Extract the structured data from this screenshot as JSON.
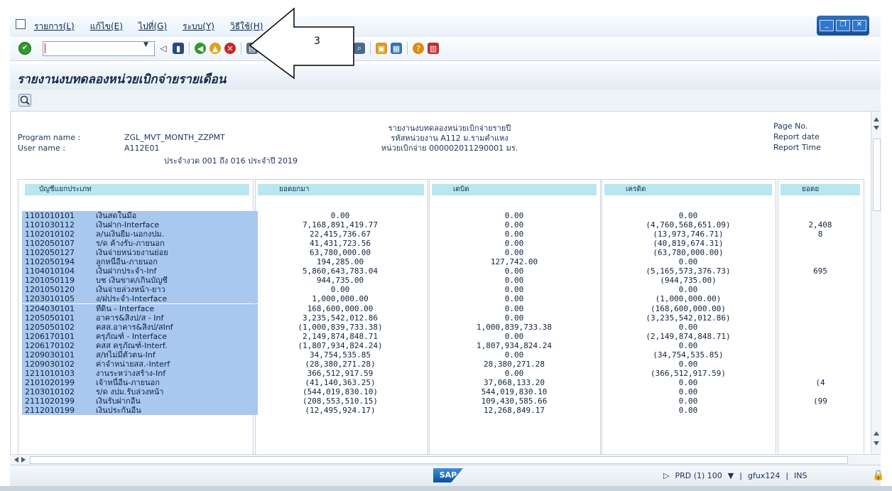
{
  "menu": {
    "items": [
      "รายการ(L)",
      "แก้ไข(E)",
      "ไปที่(G)",
      "ระบบ(Y)",
      "วิธีใช้(H)"
    ]
  },
  "toolbar": {
    "command_value": "",
    "icons": [
      "enter-icon",
      "back-icon",
      "save-icon",
      "back-green-icon",
      "exit-icon",
      "cancel-icon",
      "print-icon",
      "find-icon",
      "new-session-icon",
      "layout-icon",
      "help-icon",
      "customize-icon"
    ]
  },
  "callout": {
    "label": "3"
  },
  "title": "รายงานงบทดลองหน่วยเบิกจ่ายรายเดือน",
  "report": {
    "center_lines": [
      "รายงานงบทดลองหน่วยเบิกจ่ายรายปี",
      "รหัสหน่วยงาน A112 ม.รามคำแหง",
      "หน่วยเบิกจ่าย 000002011290001 มร."
    ],
    "program_label": "Program name  :",
    "program_value": "ZGL_MVT_MONTH_ZZPMT",
    "user_label": "User name    :",
    "user_value": "A112E01",
    "period": "ประจำงวด 001 ถึง 016 ประจำปี 2019",
    "right_labels": [
      "Page No.",
      "Report date",
      "Report Time"
    ],
    "columns": [
      "บัญชีแยกประเภท",
      "ยอดยกมา",
      "เดบิต",
      "เครดิต",
      "ยอดย"
    ],
    "rows": [
      {
        "code": "1101010101",
        "name": "เงินสดในมือ",
        "bf": "0.00",
        "debit": "0.00",
        "credit": "0.00",
        "bal": ""
      },
      {
        "code": "1101030112",
        "name": "เงินฝาก-Interface",
        "bf": "7,168,891,419.77",
        "debit": "0.00",
        "credit": "(4,760,568,651.09)",
        "bal": "2,408"
      },
      {
        "code": "1102010102",
        "name": "ล/นเงินยืม-นอกงปม.",
        "bf": "22,415,736.67",
        "debit": "0.00",
        "credit": "(13,973,746.71)",
        "bal": "8"
      },
      {
        "code": "1102050107",
        "name": "ร/ด ค้างรับ-ภายนอก",
        "bf": "41,431,723.56",
        "debit": "0.00",
        "credit": "(40,819,674.31)",
        "bal": ""
      },
      {
        "code": "1102050127",
        "name": "เงินจ่ายหน่วยงานย่อย",
        "bf": "63,780,000.00",
        "debit": "0.00",
        "credit": "(63,780,000.00)",
        "bal": ""
      },
      {
        "code": "1102050194",
        "name": "ลูกหนี้อื่น-ภายนอก",
        "bf": "194,285.00",
        "debit": "127,742.00",
        "credit": "0.00",
        "bal": ""
      },
      {
        "code": "1104010104",
        "name": "เงินฝากประจำ-Inf",
        "bf": "5,860,643,783.04",
        "debit": "0.00",
        "credit": "(5,165,573,376.73)",
        "bal": "695"
      },
      {
        "code": "1201050119",
        "name": "บช เงินขาด/เกินบัญชี",
        "bf": "944,735.00",
        "debit": "0.00",
        "credit": "(944,735.00)",
        "bal": ""
      },
      {
        "code": "1201050120",
        "name": "เงินจ่ายล่วงหน้า-ยาว",
        "bf": "0.00",
        "debit": "0.00",
        "credit": "0.00",
        "bal": ""
      },
      {
        "code": "1203010105",
        "name": "ง/ฝประจำ-Interface",
        "bf": "1,000,000.00",
        "debit": "0.00",
        "credit": "(1,000,000.00)",
        "bal": ""
      },
      {
        "code": "1204030101",
        "name": "ที่ดิน - Interface",
        "bf": "168,600,000.00",
        "debit": "0.00",
        "credit": "(168,600,000.00)",
        "bal": ""
      },
      {
        "code": "1205050101",
        "name": "อาคาร&สิ่งป/ส - Inf",
        "bf": "3,235,542,012.86",
        "debit": "0.00",
        "credit": "(3,235,542,012.86)",
        "bal": ""
      },
      {
        "code": "1205050102",
        "name": "คสส.อาคาร&สิ่งป/สInf",
        "bf": "(1,000,839,733.38)",
        "debit": "1,000,839,733.38",
        "credit": "0.00",
        "bal": ""
      },
      {
        "code": "1206170101",
        "name": "ครุภัณฑ์ - Interface",
        "bf": "2,149,874,848.71",
        "debit": "0.00",
        "credit": "(2,149,874,848.71)",
        "bal": ""
      },
      {
        "code": "1206170102",
        "name": "คสส ครุภัณฑ์-Interf.",
        "bf": "(1,807,934,824.24)",
        "debit": "1,807,934,824.24",
        "credit": "0.00",
        "bal": ""
      },
      {
        "code": "1209030101",
        "name": "ส/ทไม่มีตัวตน-Inf",
        "bf": "34,754,535.85",
        "debit": "0.00",
        "credit": "(34,754,535.85)",
        "bal": ""
      },
      {
        "code": "1209030102",
        "name": "ค่าจำหน่ายสส.-Interf",
        "bf": "(28,380,271.28)",
        "debit": "28,380,271.28",
        "credit": "0.00",
        "bal": ""
      },
      {
        "code": "1211010103",
        "name": "งานระหว่างสร้าง-Inf",
        "bf": "366,512,917.59",
        "debit": "0.00",
        "credit": "(366,512,917.59)",
        "bal": ""
      },
      {
        "code": "2101020199",
        "name": "เจ้าหนี้อื่น-ภายนอก",
        "bf": "(41,140,363.25)",
        "debit": "37,068,133.20",
        "credit": "0.00",
        "bal": "(4"
      },
      {
        "code": "2103010102",
        "name": "ร/ด งปม.รับล่วงหน้า",
        "bf": "(544,019,830.10)",
        "debit": "544,019,830.10",
        "credit": "0.00",
        "bal": ""
      },
      {
        "code": "2111020199",
        "name": "เงินรับฝากอื่น",
        "bf": "(208,553,510.15)",
        "debit": "109,430,585.66",
        "credit": "0.00",
        "bal": "(99"
      },
      {
        "code": "2112010199",
        "name": "เงินประกันอื่น",
        "bf": "(12,495,924.17)",
        "debit": "12,268,849.17",
        "credit": "0.00",
        "bal": ""
      }
    ]
  },
  "status": {
    "sap": "SAP",
    "system": "PRD (1) 100",
    "server": "gfux124",
    "mode": "INS"
  }
}
